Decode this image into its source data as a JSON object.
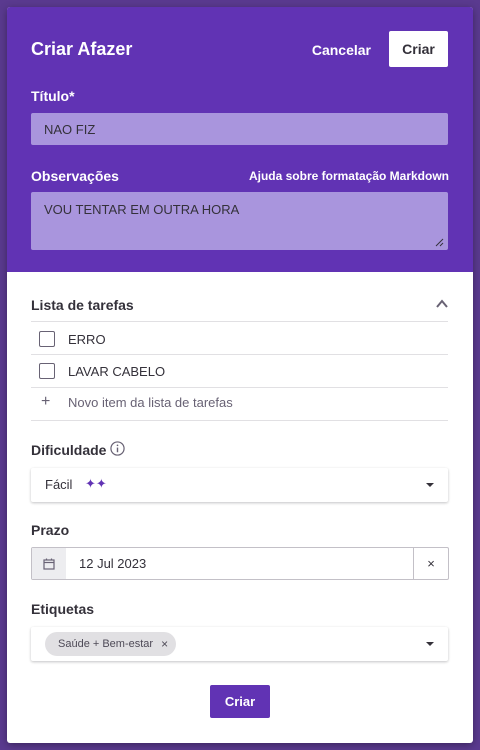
{
  "header": {
    "title": "Criar Afazer",
    "cancel_label": "Cancelar",
    "create_label": "Criar",
    "title_field_label": "Título*",
    "title_value": "NAO FIZ",
    "notes_label": "Observações",
    "markdown_help": "Ajuda sobre formatação Markdown",
    "notes_value": "VOU TENTAR EM OUTRA HORA"
  },
  "checklist": {
    "label": "Lista de tarefas",
    "items": [
      {
        "text": "ERRO",
        "checked": false
      },
      {
        "text": "LAVAR CABELO",
        "checked": false
      }
    ],
    "new_item_label": "Novo item da lista de tarefas"
  },
  "difficulty": {
    "label": "Dificuldade",
    "value": "Fácil",
    "icon": "sparkles-icon"
  },
  "due": {
    "label": "Prazo",
    "value": "12 Jul 2023",
    "clear": "×"
  },
  "tags": {
    "label": "Etiquetas",
    "selected": [
      "Saúde + Bem-estar"
    ],
    "remove": "×"
  },
  "footer": {
    "create_label": "Criar"
  },
  "colors": {
    "accent": "#6133b4",
    "input_bg": "#a995dd",
    "backdrop": "#5a3a8f"
  }
}
